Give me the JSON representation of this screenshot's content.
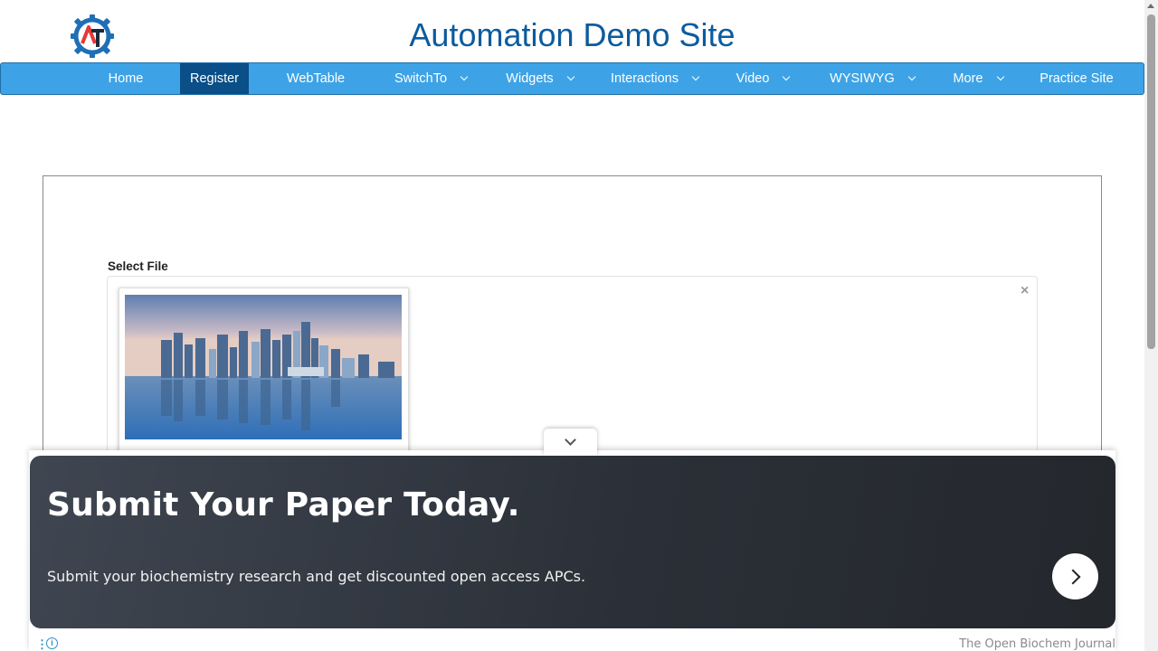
{
  "header": {
    "title": "Automation Demo Site",
    "logo_icon": "gear-at-logo-icon"
  },
  "nav": {
    "items": [
      {
        "label": "Home",
        "dropdown": false,
        "active": false
      },
      {
        "label": "Register",
        "dropdown": false,
        "active": true
      },
      {
        "label": "WebTable",
        "dropdown": false,
        "active": false
      },
      {
        "label": "SwitchTo",
        "dropdown": true,
        "active": false
      },
      {
        "label": "Widgets",
        "dropdown": true,
        "active": false
      },
      {
        "label": "Interactions",
        "dropdown": true,
        "active": false
      },
      {
        "label": "Video",
        "dropdown": true,
        "active": false
      },
      {
        "label": "WYSIWYG",
        "dropdown": true,
        "active": false
      },
      {
        "label": "More",
        "dropdown": true,
        "active": false
      },
      {
        "label": "Practice Site",
        "dropdown": false,
        "active": false
      }
    ]
  },
  "upload": {
    "label": "Select File",
    "close_symbol": "×",
    "thumbnail_icon": "city-skyline-image"
  },
  "ad": {
    "headline": "Submit Your Paper Today.",
    "subtext": "Submit your biochemistry research and get discounted open access APCs.",
    "source": "The Open Biochem Journal",
    "info_symbol": "i",
    "menu_symbol": "⋮"
  },
  "colors": {
    "nav_bg": "#3ea3e6",
    "nav_active": "#0a4f87",
    "title": "#0c5b9e"
  }
}
